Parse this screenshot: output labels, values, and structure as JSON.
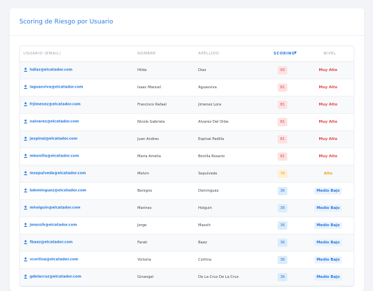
{
  "card": {
    "title": "Scoring de Riesgo por Usuario"
  },
  "table": {
    "headers": {
      "usuario": "USUARIO (EMAIL)",
      "nombre": "NOMBRE",
      "apellido": "APELLIDO",
      "scoring": "SCORING",
      "nivel": "NIVEL"
    },
    "sort_icon": "▼",
    "rows": [
      {
        "email": "hdiaz@elcatador.com",
        "nombre": "Hilda",
        "apellido": "Diaz",
        "score": "93",
        "nivel": "Muy Alto",
        "level": "high"
      },
      {
        "email": "iaguasviva@elcatador.com",
        "nombre": "Isaac Manuel",
        "apellido": "Aguasviva",
        "score": "81",
        "nivel": "Muy Alto",
        "level": "high"
      },
      {
        "email": "frjimenez@elcatador.com",
        "nombre": "Francisco Rafael",
        "apellido": "Jimenez Lora",
        "score": "81",
        "nivel": "Muy Alto",
        "level": "high"
      },
      {
        "email": "nalvarez@elcatador.com",
        "nombre": "Nicole Gabriela",
        "apellido": "Alvarez Del Orbe",
        "score": "81",
        "nivel": "Muy Alto",
        "level": "high"
      },
      {
        "email": "jespinal@elcatador.com",
        "nombre": "Juan Andres",
        "apellido": "Espinal Padilla",
        "score": "81",
        "nivel": "Muy Alto",
        "level": "high"
      },
      {
        "email": "mbonilla@elcatador.com",
        "nombre": "Maria Amelia",
        "apellido": "Bonilla Rosario",
        "score": "81",
        "nivel": "Muy Alto",
        "level": "high"
      },
      {
        "email": "msepulveda@elcatador.com",
        "nombre": "Melvin",
        "apellido": "Sepulveda",
        "score": "78",
        "nivel": "Alto",
        "level": "alto"
      },
      {
        "email": "bdominguez@elcatador.com",
        "nombre": "Benigno",
        "apellido": "Dominguez",
        "score": "36",
        "nivel": "Medio Bajo",
        "level": "med"
      },
      {
        "email": "mholguin@elcatador.com",
        "nombre": "Marines",
        "apellido": "Holguin",
        "score": "36",
        "nivel": "Medio Bajo",
        "level": "med"
      },
      {
        "email": "jmassih@elcatador.com",
        "nombre": "Jorge",
        "apellido": "Massih",
        "score": "36",
        "nivel": "Medio Bajo",
        "level": "med"
      },
      {
        "email": "fbaez@elcatador.com",
        "nombre": "Farah",
        "apellido": "Baez",
        "score": "36",
        "nivel": "Medio Bajo",
        "level": "med"
      },
      {
        "email": "vcortina@elcatador.com",
        "nombre": "Victoria",
        "apellido": "Cortina",
        "score": "36",
        "nivel": "Medio Bajo",
        "level": "med"
      },
      {
        "email": "gdelacruz@elcatador.com",
        "nombre": "Ginangel",
        "apellido": "De La Cruz De La Cruz",
        "score": "36",
        "nivel": "Medio Bajo",
        "level": "med"
      }
    ]
  },
  "icons": {
    "row_user": "user-icon",
    "sort": "sort-desc-icon"
  },
  "colors": {
    "accent": "#2a7de1",
    "muy_alto": "#e04b4b",
    "alto": "#f0a020",
    "medio_bajo": "#2a7de1"
  }
}
